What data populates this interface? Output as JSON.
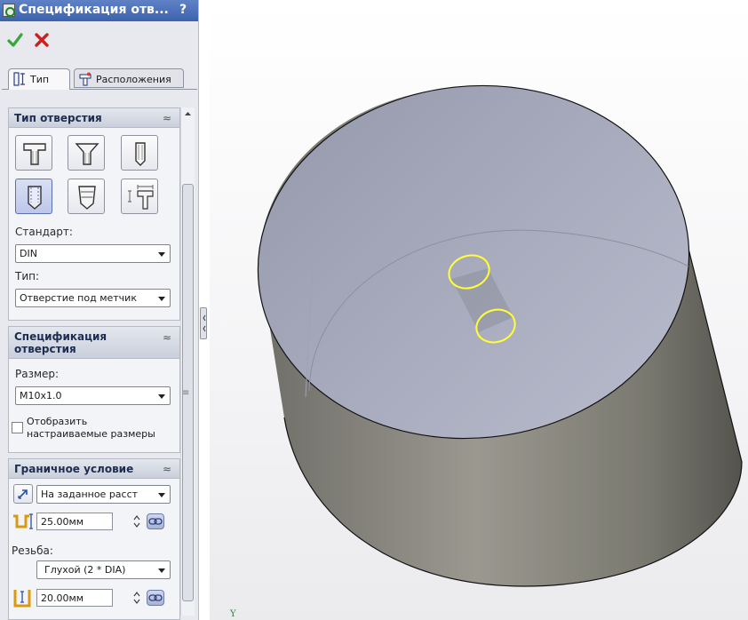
{
  "panel": {
    "title": "Спецификация отв...",
    "help_label": "?",
    "tabs": [
      {
        "label": "Тип"
      },
      {
        "label": "Расположения"
      }
    ]
  },
  "hole_type": {
    "title": "Тип отверстия",
    "standard_label": "Стандарт:",
    "standard_value": "DIN",
    "type_label": "Тип:",
    "type_value": "Отверстие под метчик"
  },
  "hole_spec": {
    "title": "Спецификация отверстия",
    "size_label": "Размер:",
    "size_value": "M10x1.0",
    "custom_sizes_label": "Отобразить настраиваемые размеры"
  },
  "end_condition": {
    "title": "Граничное условие",
    "condition_value": "На заданное расст",
    "depth_value": "25.00мм",
    "thread_label": "Резьба:",
    "thread_value": "Глухой (2 * DIA)",
    "thread_depth_value": "20.00мм"
  },
  "viewport": {
    "axis_label": "Y"
  },
  "colors": {
    "titlebar": "#4a6fb8",
    "ok": "#3aa53a",
    "cancel": "#cc1f1f",
    "highlight": "#ffff33",
    "cylinder_side": "#8d8b83",
    "cylinder_top": "#a9acbf"
  },
  "icons": [
    "ok-icon",
    "cancel-icon",
    "type-tab-icon",
    "positions-tab-icon",
    "counterbore-icon",
    "countersink-icon",
    "hole-icon",
    "tap-icon",
    "pipe-tap-icon",
    "legacy-icon",
    "direction-icon",
    "depth-icon",
    "thread-depth-icon",
    "link-icon"
  ]
}
